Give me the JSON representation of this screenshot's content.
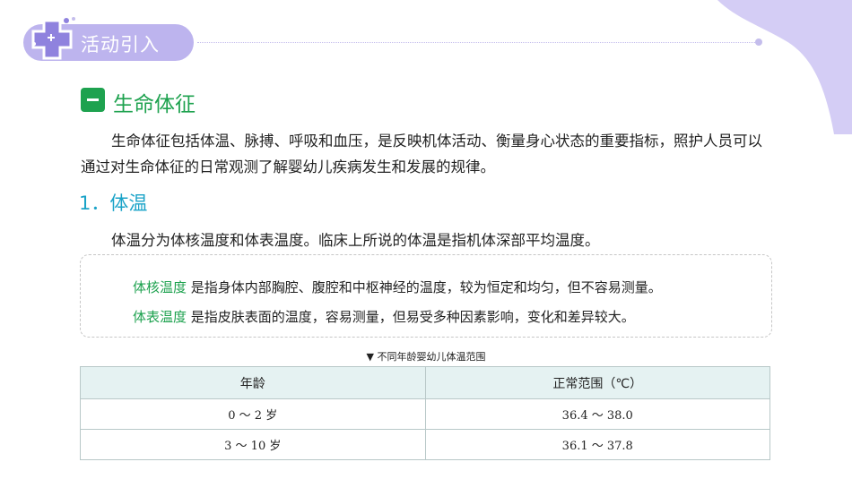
{
  "header": {
    "title": "活动引入"
  },
  "section": {
    "badge_glyph": "一",
    "title": "生命体征",
    "intro": "生命体征包括体温、脉搏、呼吸和血压，是反映机体活动、衡量身心状态的重要指标，照护人员可以通过对生命体征的日常观测了解婴幼儿疾病发生和发展的规律。"
  },
  "subsection": {
    "title": "1．体温",
    "desc": "体温分为体核温度和体表温度。临床上所说的体温是指机体深部平均温度。"
  },
  "definitions": [
    {
      "term": "体核温度",
      "text": " 是指身体内部胸腔、腹腔和中枢神经的温度，较为恒定和均匀，但不容易测量。"
    },
    {
      "term": "体表温度",
      "text": " 是指皮肤表面的温度，容易测量，但易受多种因素影响，变化和差异较大。"
    }
  ],
  "table": {
    "caption": "▼  不同年龄婴幼儿体温范围",
    "headers": [
      "年龄",
      "正常范围（℃）"
    ],
    "rows": [
      [
        "0 ～ 2 岁",
        "36.4 ～ 38.0"
      ],
      [
        "3 ～ 10 岁",
        "36.1 ～ 37.8"
      ]
    ]
  },
  "colors": {
    "accent_green": "#1ea24f",
    "accent_blue": "#1aa3c8",
    "header_purple": "#bdb4ee"
  }
}
